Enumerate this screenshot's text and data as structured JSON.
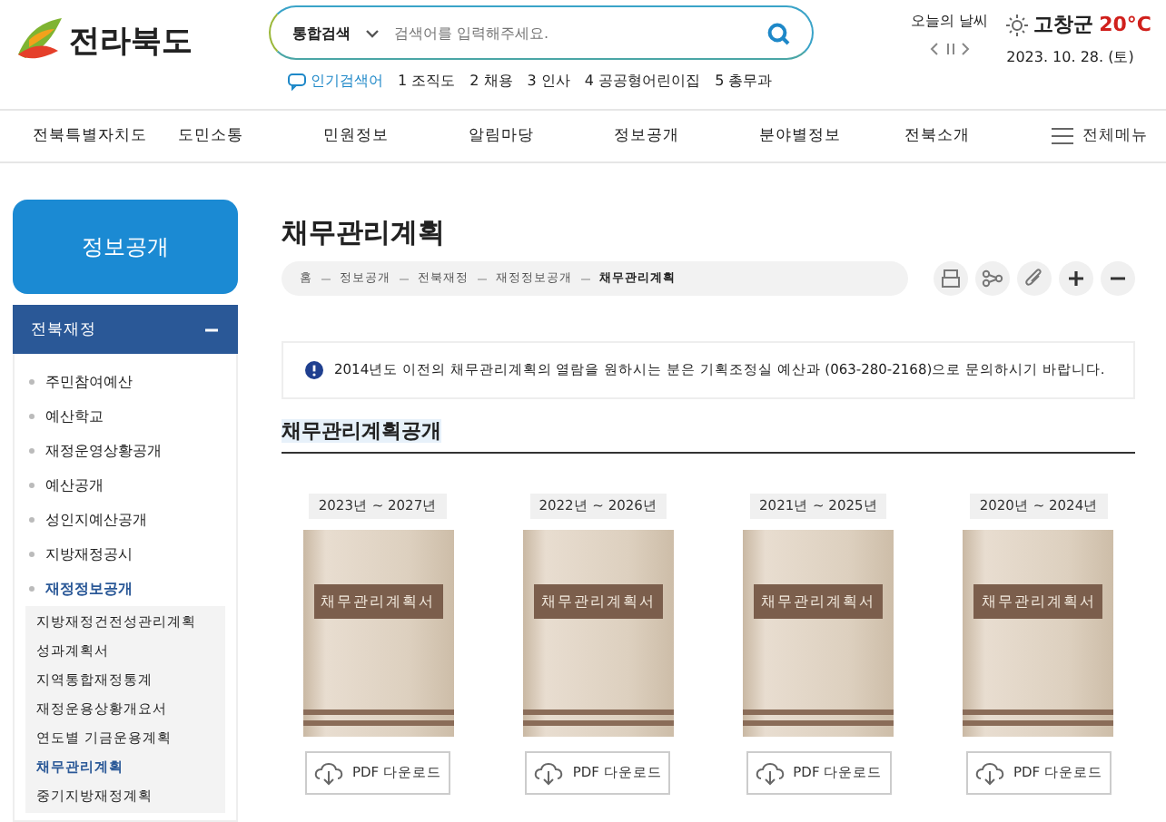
{
  "header": {
    "logo": "전라북도",
    "search": {
      "scope": "통합검색",
      "placeholder": "검색어를 입력해주세요."
    },
    "popular": {
      "label": "인기검색어",
      "items": [
        "1 조직도",
        "2 채용",
        "3 인사",
        "4 공공형어린이집",
        "5 총무과"
      ]
    },
    "weather": {
      "label": "오늘의 날씨",
      "place": "고창군",
      "temp": "20°C",
      "date": "2023. 10. 28. (토)"
    }
  },
  "nav": {
    "items": [
      "전북특별자치도",
      "도민소통",
      "민원정보",
      "알림마당",
      "정보공개",
      "분야별정보",
      "전북소개"
    ],
    "all_menu": "전체메뉴"
  },
  "sidebar": {
    "title": "정보공개",
    "section": {
      "label": "전북재정",
      "expanded": true
    },
    "items": [
      {
        "label": "주민참여예산",
        "selected": false
      },
      {
        "label": "예산학교",
        "selected": false
      },
      {
        "label": "재정운영상황공개",
        "selected": false
      },
      {
        "label": "예산공개",
        "selected": false
      },
      {
        "label": "성인지예산공개",
        "selected": false
      },
      {
        "label": "지방재정공시",
        "selected": false
      },
      {
        "label": "재정정보공개",
        "selected": true,
        "children": [
          {
            "label": "지방재정건전성관리계획",
            "selected": false
          },
          {
            "label": "성과계획서",
            "selected": false
          },
          {
            "label": "지역통합재정통계",
            "selected": false
          },
          {
            "label": "재정운용상황개요서",
            "selected": false
          },
          {
            "label": "연도별 기금운용계획",
            "selected": false
          },
          {
            "label": "채무관리계획",
            "selected": true
          },
          {
            "label": "중기지방재정계획",
            "selected": false
          }
        ]
      }
    ]
  },
  "main": {
    "title": "채무관리계획",
    "breadcrumb": [
      "홈",
      "정보공개",
      "전북재정",
      "재정정보공개",
      "채무관리계획"
    ],
    "notice": "2014년도 이전의 채무관리계획의 열람을 원하시는 분은 기획조정실 예산과 (063-280-2168)으로 문의하시기 바랍니다.",
    "subtitle": "채무관리계획공개",
    "books": [
      {
        "period": "2023년 ~ 2027년",
        "cover_title": "채무관리계획서",
        "button": "PDF 다운로드"
      },
      {
        "period": "2022년 ~ 2026년",
        "cover_title": "채무관리계획서",
        "button": "PDF 다운로드"
      },
      {
        "period": "2021년 ~ 2025년",
        "cover_title": "채무관리계획서",
        "button": "PDF 다운로드"
      },
      {
        "period": "2020년 ~ 2024년",
        "cover_title": "채무관리계획서",
        "button": "PDF 다운로드"
      }
    ]
  }
}
